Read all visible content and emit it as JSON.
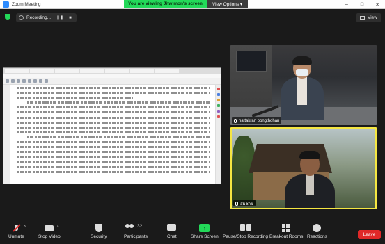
{
  "window": {
    "title": "Zoom Meeting",
    "controls": [
      "–",
      "□",
      "✕"
    ]
  },
  "banner": {
    "viewing_text": "You are viewing Jitwimon's screen",
    "options_label": "View Options ▾"
  },
  "topbar": {
    "recording_label": "Recording...",
    "pause_label": "❚❚",
    "stop_label": "■",
    "view_label": "View"
  },
  "colors": {
    "zoom_blue": "#2d8cff",
    "share_green": "#23d959",
    "active_speaker_yellow": "#f5e642",
    "leave_red": "#e02828"
  },
  "participants": [
    {
      "name": "nattakran pongthohan",
      "muted": true
    },
    {
      "name": "สมชาย",
      "muted": true,
      "active_speaker": true
    }
  ],
  "controls": {
    "unmute": "Unmute",
    "stop_video": "Stop Video",
    "security": "Security",
    "participants": "Participants",
    "participants_count": "32",
    "chat": "Chat",
    "share_screen": "Share Screen",
    "record": "Pause/Stop Recording",
    "breakout": "Breakout Rooms",
    "reactions": "Reactions",
    "leave": "Leave"
  }
}
